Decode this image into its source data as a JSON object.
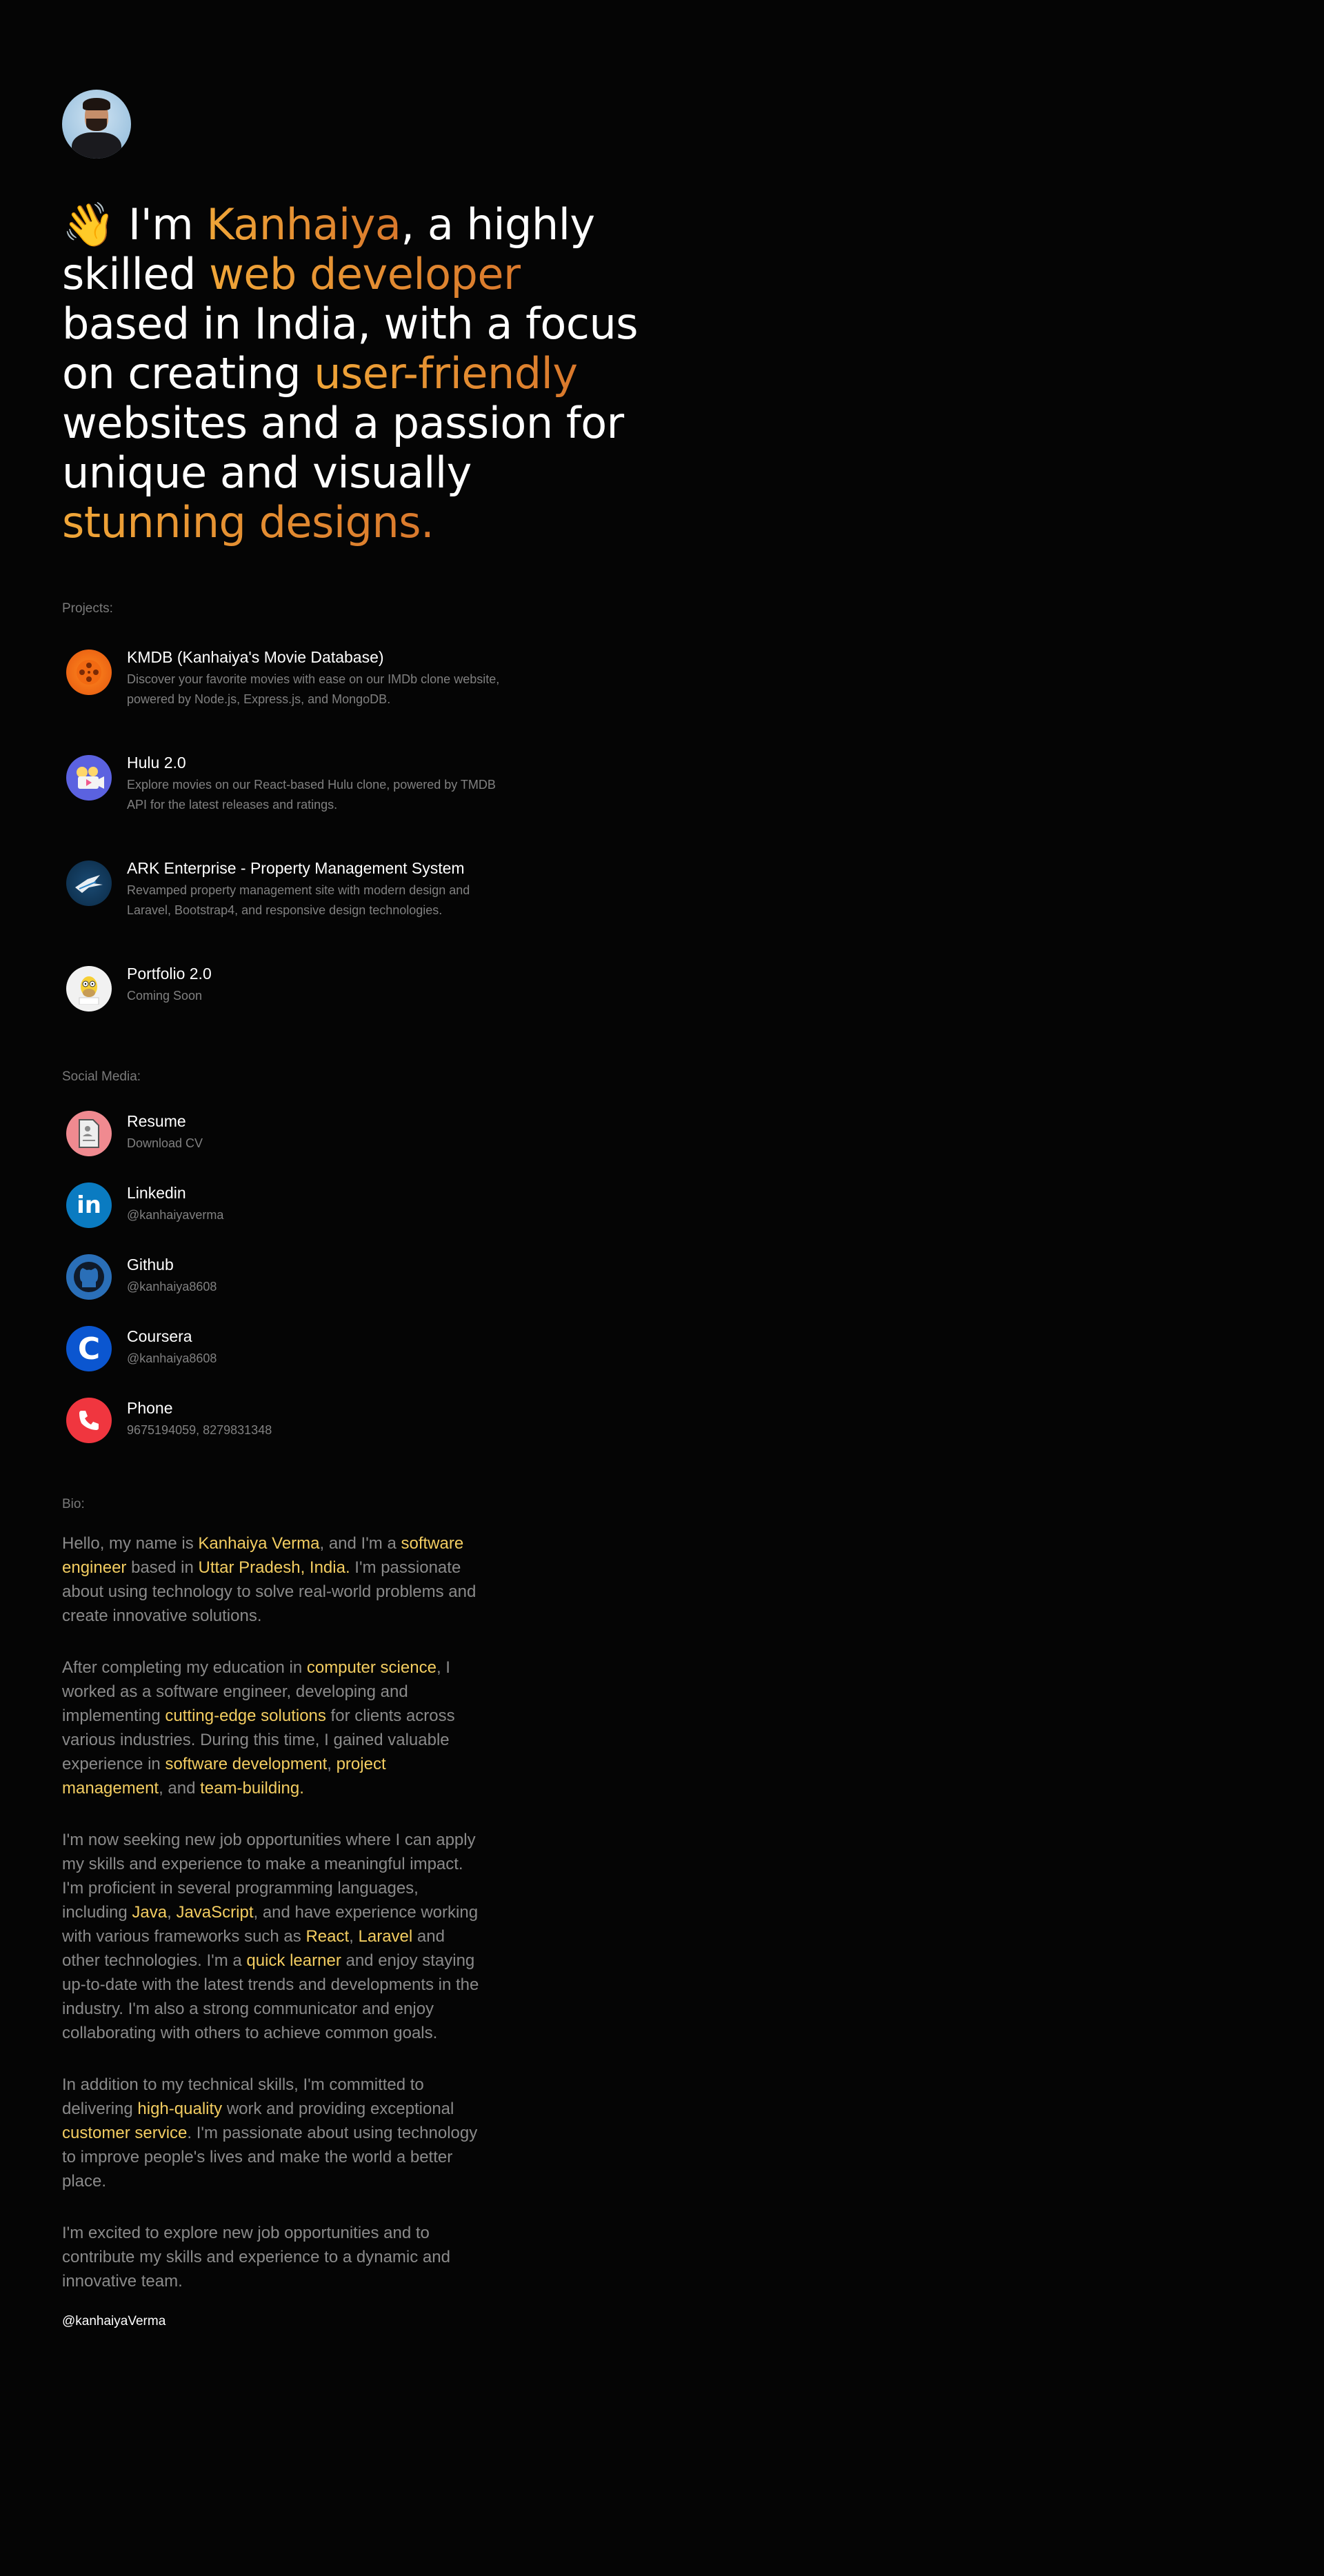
{
  "hero": {
    "wave": "👋",
    "t1": " I'm ",
    "name": "Kanhaiya",
    "t2": ", a highly skilled ",
    "role": "web developer",
    "t3": " based in India, with a focus on creating ",
    "uf": "user-friendly",
    "t4": " websites and a passion for unique and visually ",
    "sd": "stunning designs."
  },
  "projects": {
    "label": "Projects:",
    "items": [
      {
        "title": "KMDB (Kanhaiya's Movie Database)",
        "desc": "Discover your favorite movies with ease on our IMDb clone website, powered by Node.js, Express.js, and MongoDB.",
        "icon": "film-reel-icon"
      },
      {
        "title": "Hulu 2.0",
        "desc": "Explore movies on our React-based Hulu clone, powered by TMDB API for the latest releases and ratings.",
        "icon": "movie-projector-icon"
      },
      {
        "title": "ARK Enterprise - Property Management System",
        "desc": "Revamped property management site with modern design and Laravel, Bootstrap4, and responsive design technologies.",
        "icon": "ark-logo-icon"
      },
      {
        "title": "Portfolio 2.0",
        "desc": "Coming Soon",
        "icon": "homer-avatar-icon"
      }
    ]
  },
  "social": {
    "label": "Social Media:",
    "items": [
      {
        "title": "Resume",
        "desc": "Download CV",
        "icon": "document-icon",
        "color": "#ef8a8f"
      },
      {
        "title": "Linkedin",
        "desc": "@kanhaiyaverma",
        "icon": "linkedin-icon",
        "color": "#0a7bc1"
      },
      {
        "title": "Github",
        "desc": "@kanhaiya8608",
        "icon": "github-icon",
        "color": "#2a6fb8"
      },
      {
        "title": "Coursera",
        "desc": "@kanhaiya8608",
        "icon": "coursera-icon",
        "color": "#0b56d0"
      },
      {
        "title": "Phone",
        "desc": "9675194059, 8279831348",
        "icon": "phone-icon",
        "color": "#f0363f"
      }
    ]
  },
  "bio": {
    "label": "Bio:",
    "p1": {
      "a": "Hello, my name is ",
      "b": "Kanhaiya Verma",
      "c": ", and I'm a ",
      "d": "software engineer",
      "e": " based in ",
      "f": "Uttar Pradesh, India.",
      "g": " I'm passionate about using technology to solve real-world problems and create innovative solutions."
    },
    "p2": {
      "a": "After completing my education in ",
      "b": "computer science",
      "c": ", I worked as a software engineer, developing and implementing ",
      "d": "cutting-edge solutions",
      "e": " for clients across various industries. During this time, I gained valuable experience in ",
      "f": "software development",
      "g": ", ",
      "h": "project management",
      "i": ", and ",
      "j": "team-building."
    },
    "p3": {
      "a": "I'm now seeking new job opportunities where I can apply my skills and experience to make a meaningful impact. I'm proficient in several programming languages, including ",
      "b": "Java",
      "c": ", ",
      "d": "JavaScript",
      "e": ", and have experience working with various frameworks such as ",
      "f": "React",
      "g": ", ",
      "h": "Laravel",
      "i": " and other technologies. I'm a ",
      "j": "quick learner",
      "k": " and enjoy staying up-to-date with the latest trends and developments in the industry. I'm also a strong communicator and enjoy collaborating with others to achieve common goals."
    },
    "p4": {
      "a": "In addition to my technical skills, I'm committed to delivering ",
      "b": "high-quality",
      "c": " work and providing exceptional ",
      "d": "customer service",
      "e": ". I'm passionate about using technology to improve people's lives and make the world a better place."
    },
    "p5": {
      "a": "I'm excited to explore new job opportunities and to contribute my skills and experience to a dynamic and innovative team."
    }
  },
  "footer": {
    "handle": "@kanhaiyaVerma"
  }
}
